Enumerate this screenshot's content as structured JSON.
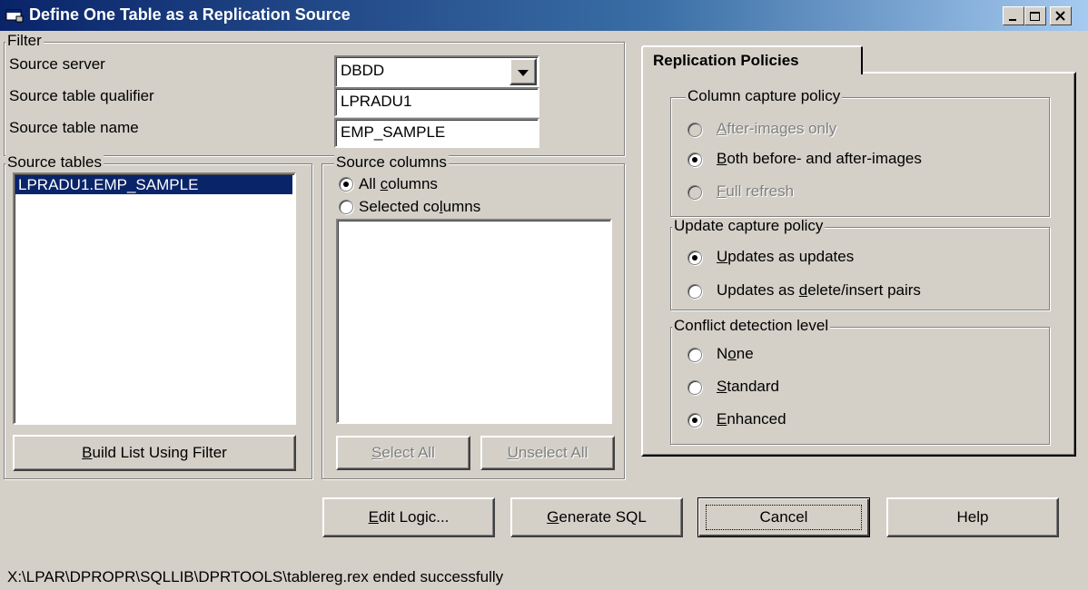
{
  "window": {
    "title": "Define One Table as a Replication Source",
    "controls": [
      "minimize",
      "maximize",
      "close"
    ]
  },
  "filter": {
    "legend": "Filter",
    "server_label": "Source server",
    "server_value": "DBDD",
    "qualifier_label": "Source table qualifier",
    "qualifier_value": "LPRADU1",
    "name_label": "Source table name",
    "name_value": "EMP_SAMPLE"
  },
  "source_tables": {
    "legend": "Source tables",
    "items": [
      "LPRADU1.EMP_SAMPLE"
    ],
    "selected_index": 0,
    "build_button": {
      "pre": "",
      "key": "B",
      "post": "uild List Using Filter"
    }
  },
  "source_columns": {
    "legend": "Source columns",
    "all": {
      "pre": "All ",
      "key": "c",
      "post": "olumns",
      "checked": true
    },
    "selected": {
      "pre": "Selected co",
      "key": "l",
      "post": "umns",
      "checked": false
    },
    "select_all": {
      "pre": "",
      "key": "S",
      "post": "elect All",
      "enabled": false
    },
    "unselect_all": {
      "pre": "",
      "key": "U",
      "post": "nselect All",
      "enabled": false
    }
  },
  "tab": {
    "label": "Replication Policies",
    "column_capture": {
      "legend": "Column capture policy",
      "after_only": {
        "pre": "",
        "key": "A",
        "post": "fter-images only",
        "checked": false,
        "enabled": false
      },
      "both": {
        "pre": "",
        "key": "B",
        "post": "oth before- and after-images",
        "checked": true,
        "enabled": true
      },
      "full_refresh": {
        "pre": "",
        "key": "F",
        "post": "ull refresh",
        "checked": false,
        "enabled": false
      }
    },
    "update_capture": {
      "legend": "Update capture policy",
      "as_updates": {
        "pre": "",
        "key": "U",
        "post": "pdates as updates",
        "checked": true
      },
      "as_pairs": {
        "pre": "Updates as ",
        "key": "d",
        "post": "elete/insert pairs",
        "checked": false
      }
    },
    "conflict": {
      "legend": "Conflict detection level",
      "none": {
        "pre": "N",
        "key": "o",
        "post": "ne",
        "checked": false
      },
      "standard": {
        "pre": "",
        "key": "S",
        "post": "tandard",
        "checked": false
      },
      "enhanced": {
        "pre": "",
        "key": "E",
        "post": "nhanced",
        "checked": true
      }
    }
  },
  "buttons": {
    "edit_logic": {
      "pre": "",
      "key": "E",
      "post": "dit Logic..."
    },
    "generate_sql": {
      "pre": "",
      "key": "G",
      "post": "enerate SQL"
    },
    "cancel": "Cancel",
    "help": "Help"
  },
  "status": "X:\\LPAR\\DPROPR\\SQLLIB\\DPRTOOLS\\tablereg.rex ended successfully"
}
